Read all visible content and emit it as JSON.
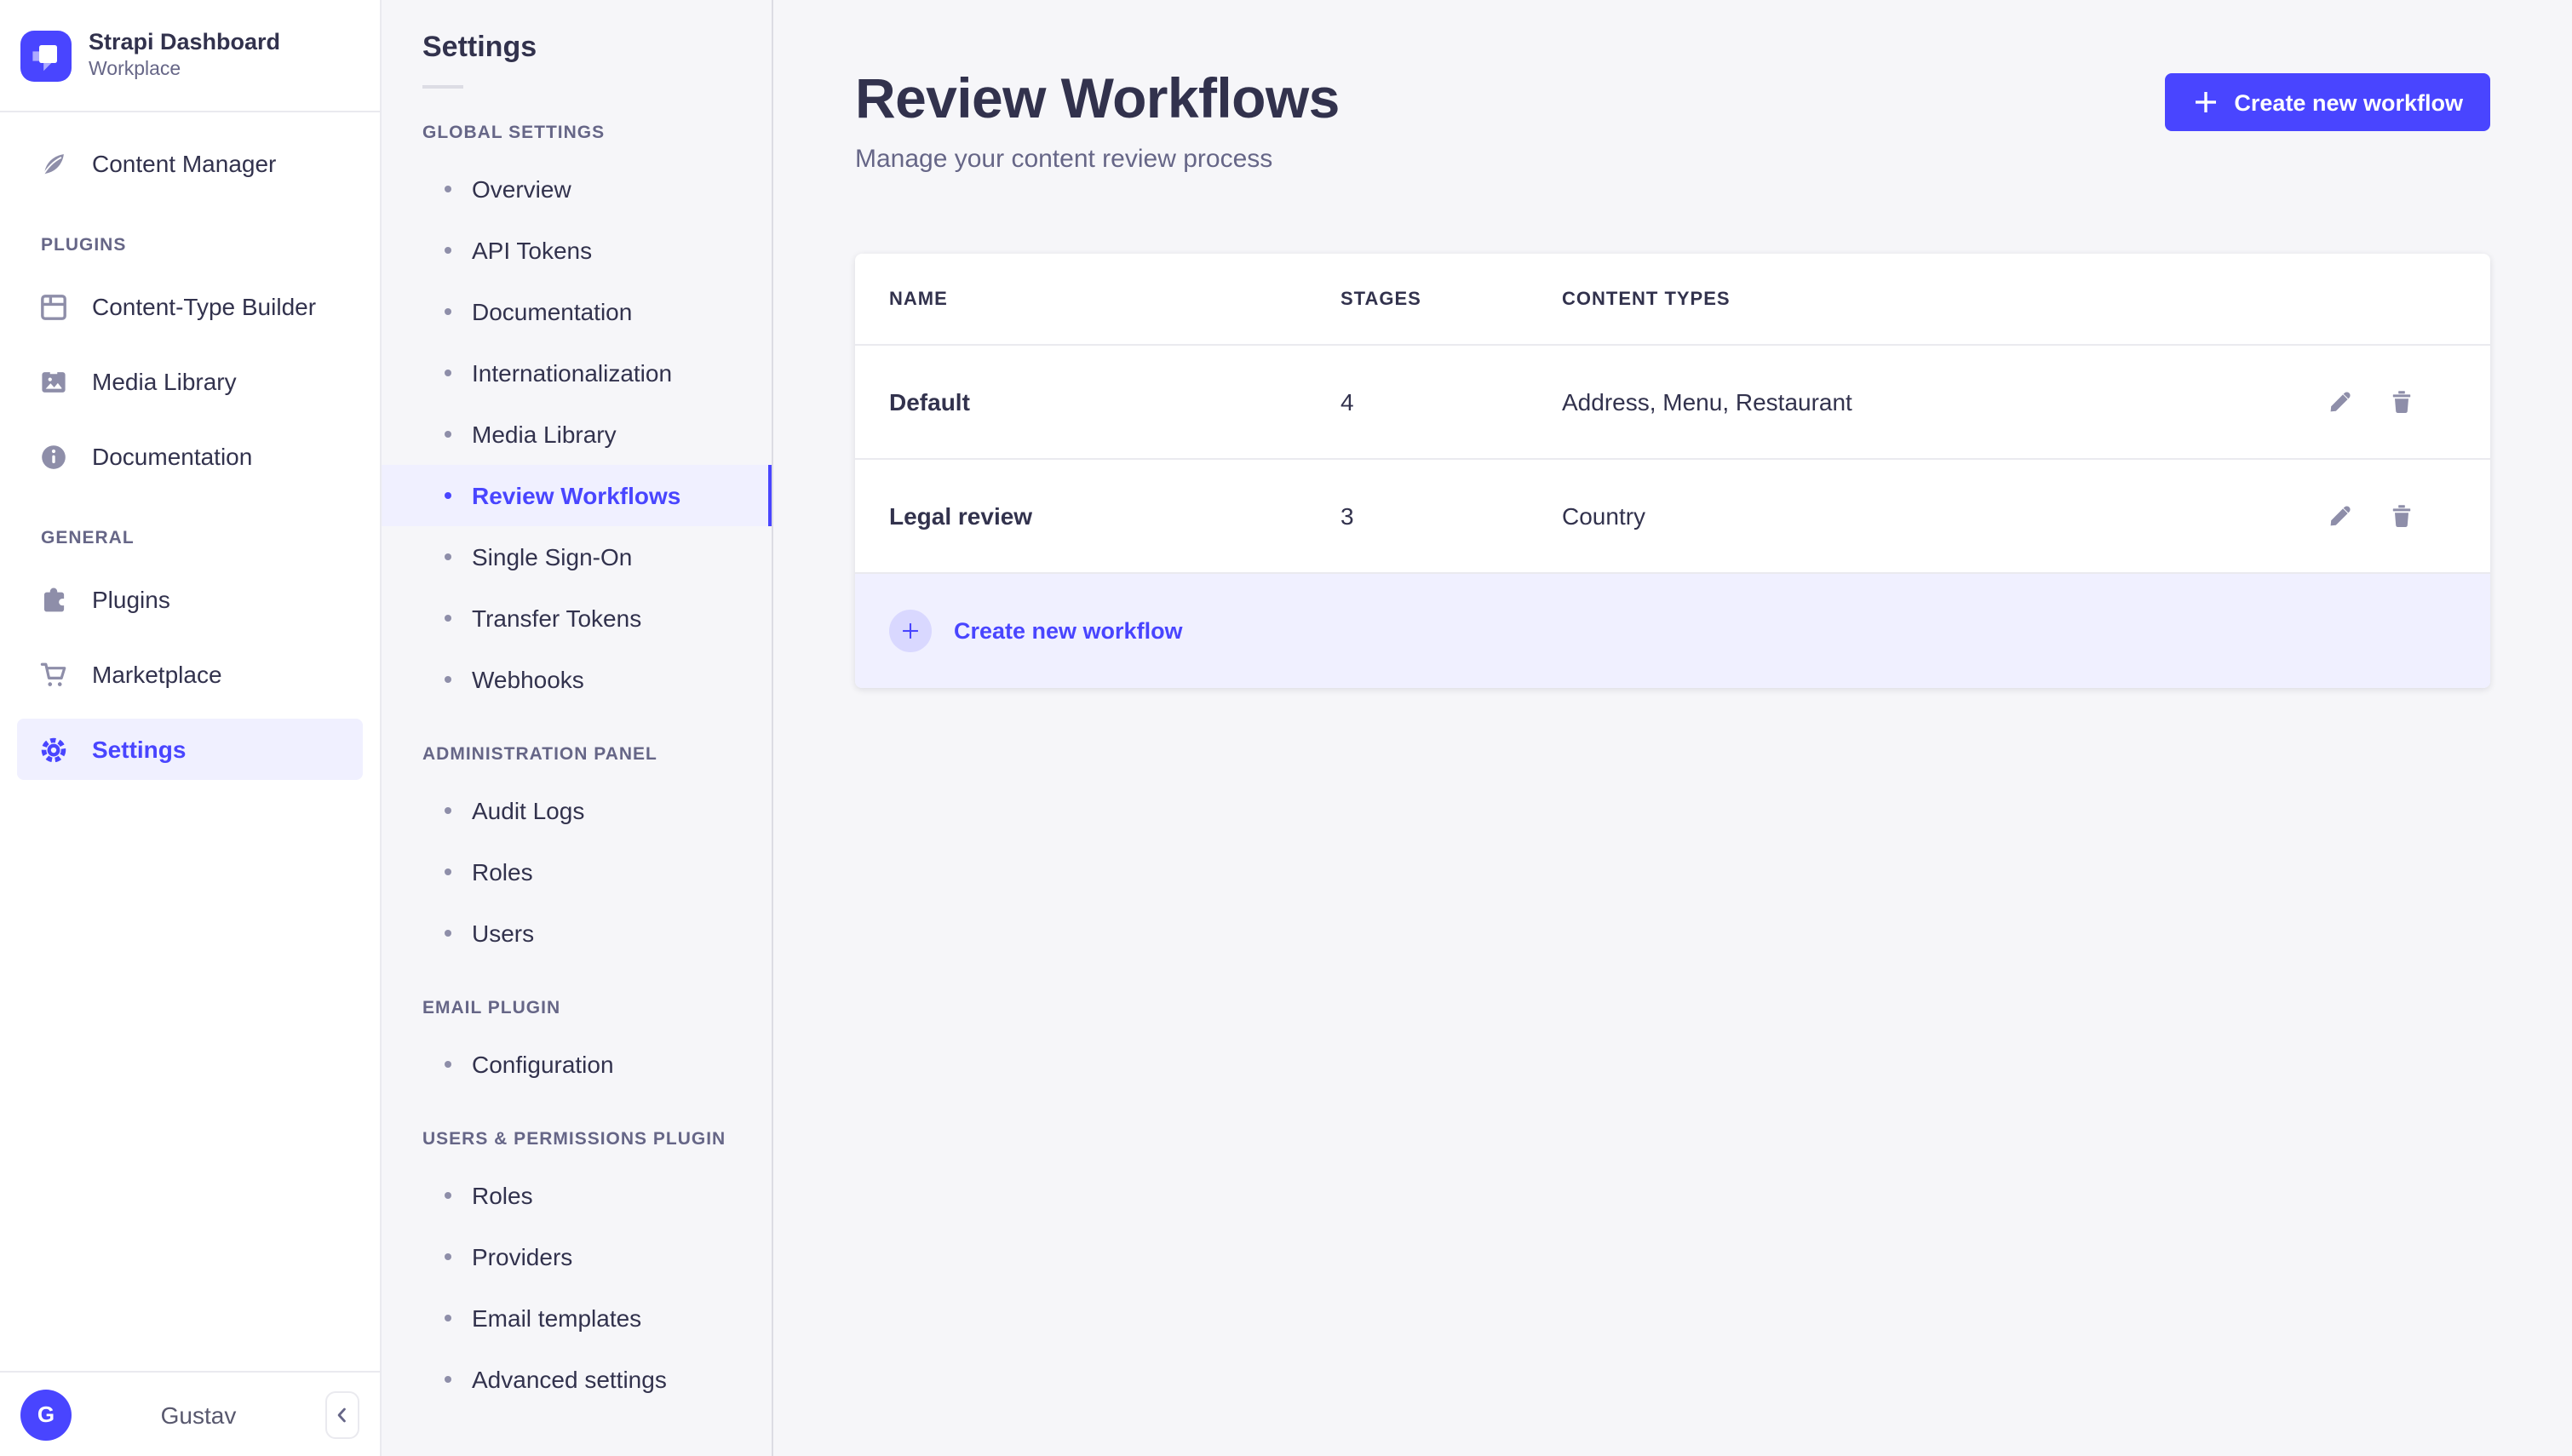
{
  "colors": {
    "accent": "#4945FF",
    "accent_light_bg": "#F0F0FF",
    "accent_circle": "#D9D8FF",
    "text_dark": "#32324D",
    "text_muted": "#666687",
    "icon_gray": "#8E8EA9",
    "app_bg": "#F6F6F9",
    "panel_bg": "#FFFFFF",
    "border": "#EAEAEF"
  },
  "brand": {
    "title": "Strapi Dashboard",
    "subtitle": "Workplace"
  },
  "main_nav": {
    "items_top": [
      {
        "label": "Content Manager",
        "icon": "pen-icon"
      }
    ],
    "sections": [
      {
        "title": "PLUGINS",
        "items": [
          {
            "label": "Content-Type Builder",
            "icon": "layout-icon"
          },
          {
            "label": "Media Library",
            "icon": "image-icon"
          },
          {
            "label": "Documentation",
            "icon": "info-icon"
          }
        ]
      },
      {
        "title": "GENERAL",
        "items": [
          {
            "label": "Plugins",
            "icon": "puzzle-icon"
          },
          {
            "label": "Marketplace",
            "icon": "cart-icon"
          },
          {
            "label": "Settings",
            "icon": "gear-icon",
            "active": true
          }
        ]
      }
    ],
    "user": {
      "name": "Gustav",
      "initial": "G"
    }
  },
  "subnav": {
    "title": "Settings",
    "sections": [
      {
        "title": "GLOBAL SETTINGS",
        "items": [
          {
            "label": "Overview"
          },
          {
            "label": "API Tokens"
          },
          {
            "label": "Documentation"
          },
          {
            "label": "Internationalization"
          },
          {
            "label": "Media Library"
          },
          {
            "label": "Review Workflows",
            "active": true
          },
          {
            "label": "Single Sign-On"
          },
          {
            "label": "Transfer Tokens"
          },
          {
            "label": "Webhooks"
          }
        ]
      },
      {
        "title": "ADMINISTRATION PANEL",
        "items": [
          {
            "label": "Audit Logs"
          },
          {
            "label": "Roles"
          },
          {
            "label": "Users"
          }
        ]
      },
      {
        "title": "EMAIL PLUGIN",
        "items": [
          {
            "label": "Configuration"
          }
        ]
      },
      {
        "title": "USERS & PERMISSIONS PLUGIN",
        "items": [
          {
            "label": "Roles"
          },
          {
            "label": "Providers"
          },
          {
            "label": "Email templates"
          },
          {
            "label": "Advanced settings"
          }
        ]
      }
    ]
  },
  "page": {
    "title": "Review Workflows",
    "subtitle": "Manage your content review process",
    "create_button_label": "Create new workflow"
  },
  "table": {
    "columns": {
      "name": "NAME",
      "stages": "STAGES",
      "content_types": "CONTENT TYPES"
    },
    "rows": [
      {
        "name": "Default",
        "stages": "4",
        "content_types": "Address, Menu, Restaurant"
      },
      {
        "name": "Legal review",
        "stages": "3",
        "content_types": "Country"
      }
    ],
    "footer_label": "Create new workflow"
  }
}
